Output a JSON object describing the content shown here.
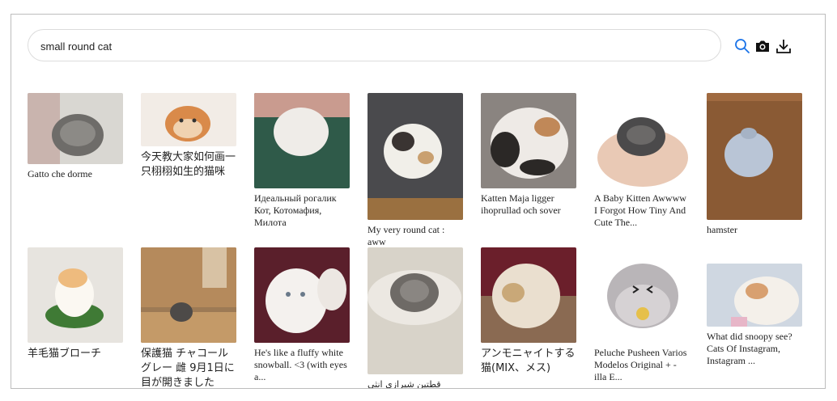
{
  "search": {
    "query": "small round cat"
  },
  "toolbar": {
    "icons": [
      "search-icon",
      "camera-icon",
      "download-icon"
    ]
  },
  "results": [
    {
      "caption": "Gatto che dorme",
      "colors": [
        "#d9d7d2",
        "#6e6c69"
      ]
    },
    {
      "caption": "今天教大家如何画一只栩栩如生的猫咪",
      "colors": [
        "#f2ece6",
        "#d98a4a"
      ]
    },
    {
      "caption": "Идеальный рогалик Кот, Котомафия, Милота",
      "colors": [
        "#2f5a49",
        "#efece8"
      ]
    },
    {
      "caption": "My very round cat : aww",
      "colors": [
        "#4a4a4d",
        "#f1efe9"
      ]
    },
    {
      "caption": "Katten Maja ligger ihoprullad och sover",
      "colors": [
        "#8a8480",
        "#eeeae6"
      ]
    },
    {
      "caption": "A Baby Kitten Awwww I Forgot How Tiny And Cute The...",
      "colors": [
        "#e9c9b5",
        "#4b4a4b"
      ]
    },
    {
      "caption": "hamster",
      "colors": [
        "#8a5a34",
        "#b9c5d6"
      ]
    },
    {
      "caption": "羊毛猫ブローチ",
      "colors": [
        "#e7e4df",
        "#eebb7e"
      ]
    },
    {
      "caption": "保護猫 チャコールグレー 雌 9月1日に目が開きました",
      "colors": [
        "#9d7a55",
        "#4d4a48"
      ]
    },
    {
      "caption": "He's like a fluffy white snowball. <3 (with eyes a...",
      "colors": [
        "#5a1f2b",
        "#f4f1ee"
      ]
    },
    {
      "caption": "قطتين شيرازي انثى بصحه",
      "colors": [
        "#d8d3c9",
        "#6e6a66"
      ]
    },
    {
      "caption": "アンモニャイトする猫(MIX、メス)",
      "colors": [
        "#6b1f2b",
        "#eadfcf"
      ]
    },
    {
      "caption": "Peluche Pusheen Varios Modelos Original + - illa E...",
      "colors": [
        "#ffffff",
        "#b9b5b8"
      ]
    },
    {
      "caption": "What did snoopy see? Cats Of Instagram, Instagram ...",
      "colors": [
        "#cfd7e1",
        "#f4f0ea"
      ]
    }
  ]
}
